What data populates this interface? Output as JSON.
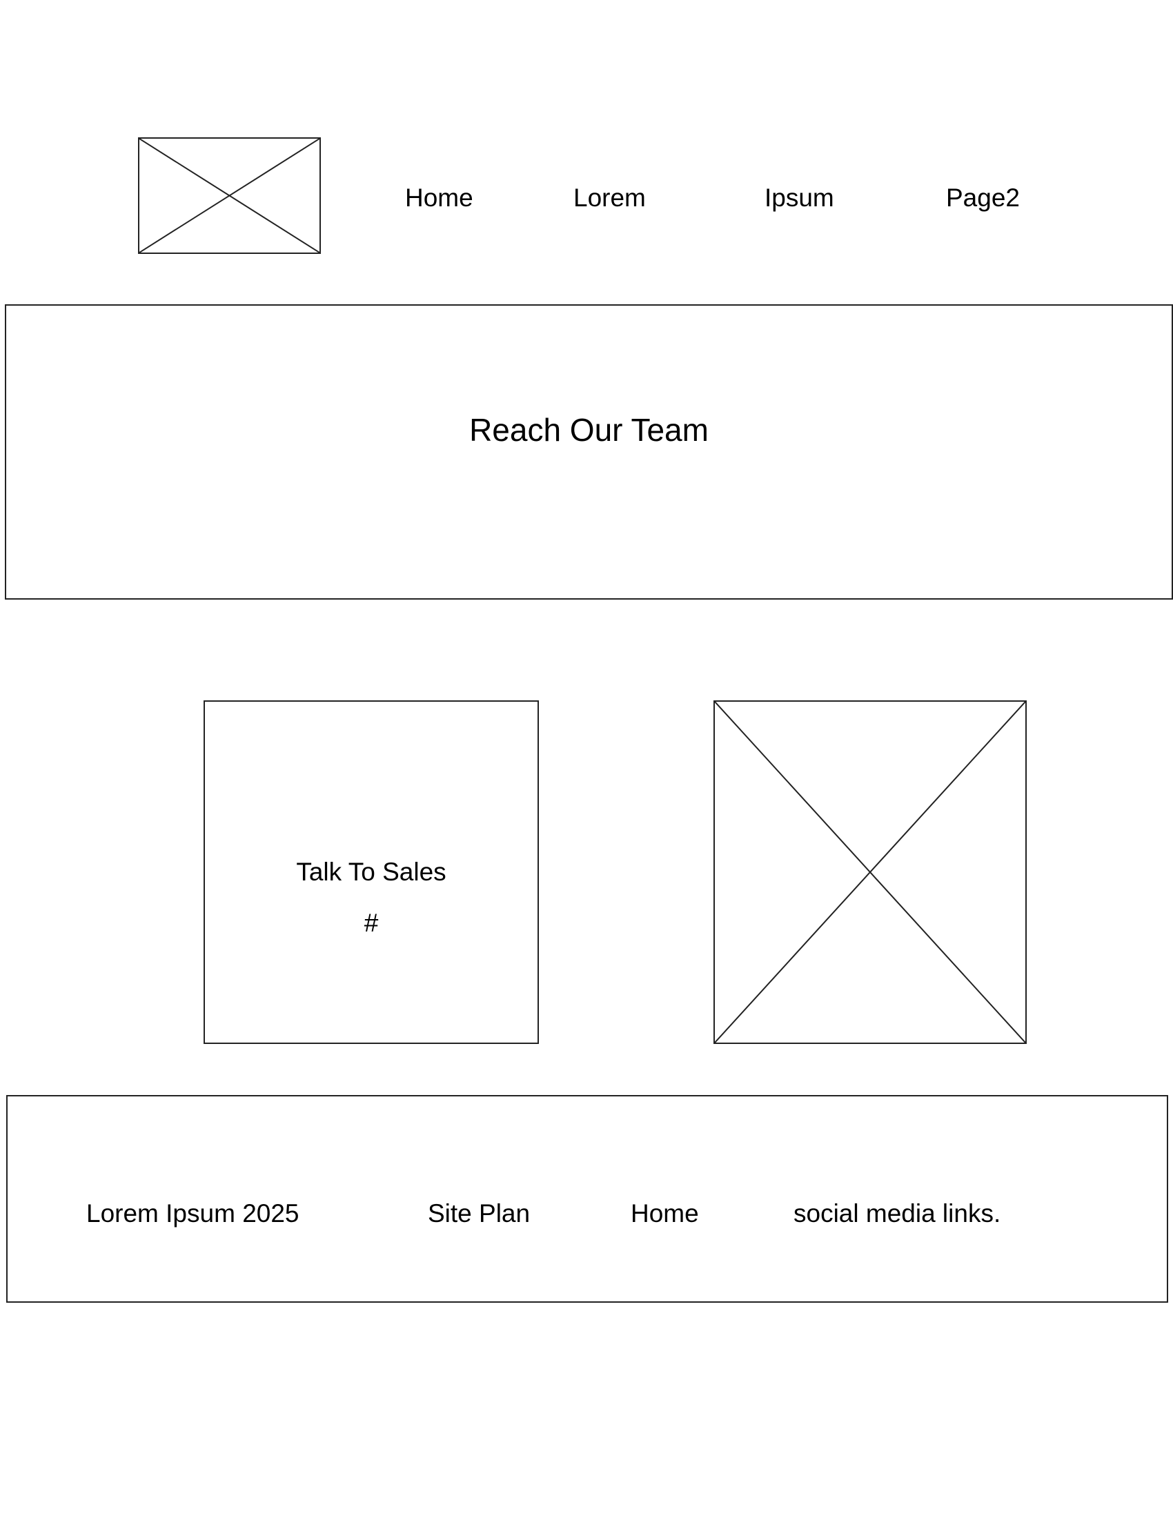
{
  "header": {
    "logo_icon": "image-placeholder-icon",
    "nav": [
      "Home",
      "Lorem",
      "Ipsum",
      "Page2"
    ]
  },
  "hero": {
    "title": "Reach Our Team"
  },
  "contact_card": {
    "title": "Talk To Sales",
    "phone": "#"
  },
  "media": {
    "icon": "image-placeholder-icon"
  },
  "footer": {
    "copyright": "Lorem Ipsum 2025",
    "links": [
      "Site Plan",
      "Home",
      "social media links."
    ]
  }
}
